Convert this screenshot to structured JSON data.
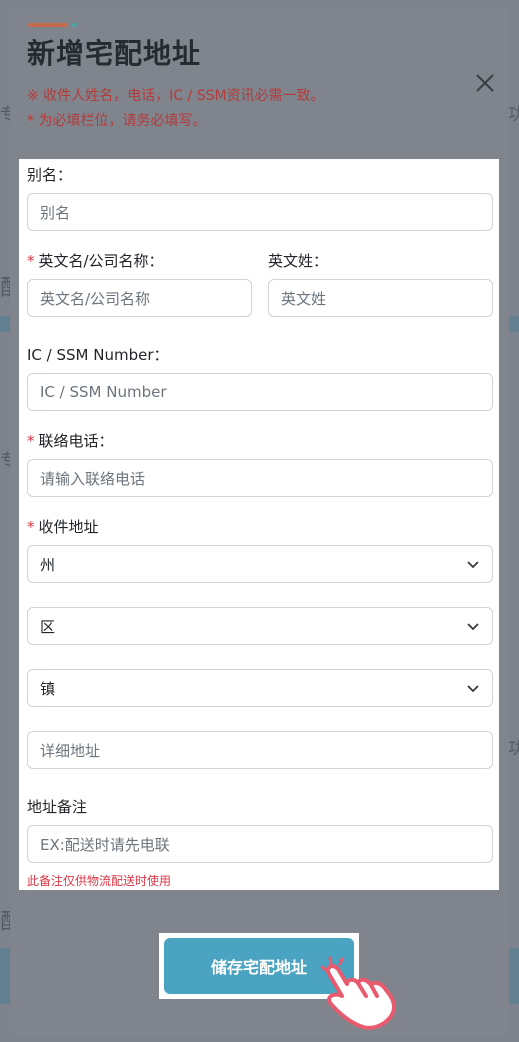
{
  "modal": {
    "title": "新增宅配地址",
    "note_1": "※ 收件人姓名，电话，IC / SSM资讯必需一致。",
    "note_2": "* 为必填栏位，请务必填写。",
    "close_icon": "close-icon"
  },
  "form": {
    "alias": {
      "label": "别名：",
      "placeholder": "别名"
    },
    "first_name": {
      "required_mark": "*",
      "label": "英文名/公司名称：",
      "placeholder": "英文名/公司名称"
    },
    "last_name": {
      "label": "英文姓：",
      "placeholder": "英文姓"
    },
    "ic": {
      "label": "IC / SSM Number：",
      "placeholder": "IC / SSM Number"
    },
    "phone": {
      "required_mark": "*",
      "label": "联络电话：",
      "placeholder": "请输入联络电话"
    },
    "address": {
      "required_mark": "*",
      "label": "收件地址",
      "state": "州",
      "district": "区",
      "town": "镇",
      "detail_placeholder": "详细地址"
    },
    "remark": {
      "label": "地址备注",
      "placeholder": "EX:配送时请先电联",
      "hint": "此备注仅供物流配送时使用"
    }
  },
  "save_button": {
    "label": "储存宅配地址"
  },
  "background_glyphs": {
    "left_1": "专",
    "left_2": "配",
    "left_3": "专",
    "left_4": "配",
    "right_1": "功",
    "right_2": "功"
  },
  "colors": {
    "accent_primary": "#4aa3c1",
    "required_red": "#dc3545",
    "note_red": "#b33a3a",
    "hand_pink": "#e85a6e"
  }
}
